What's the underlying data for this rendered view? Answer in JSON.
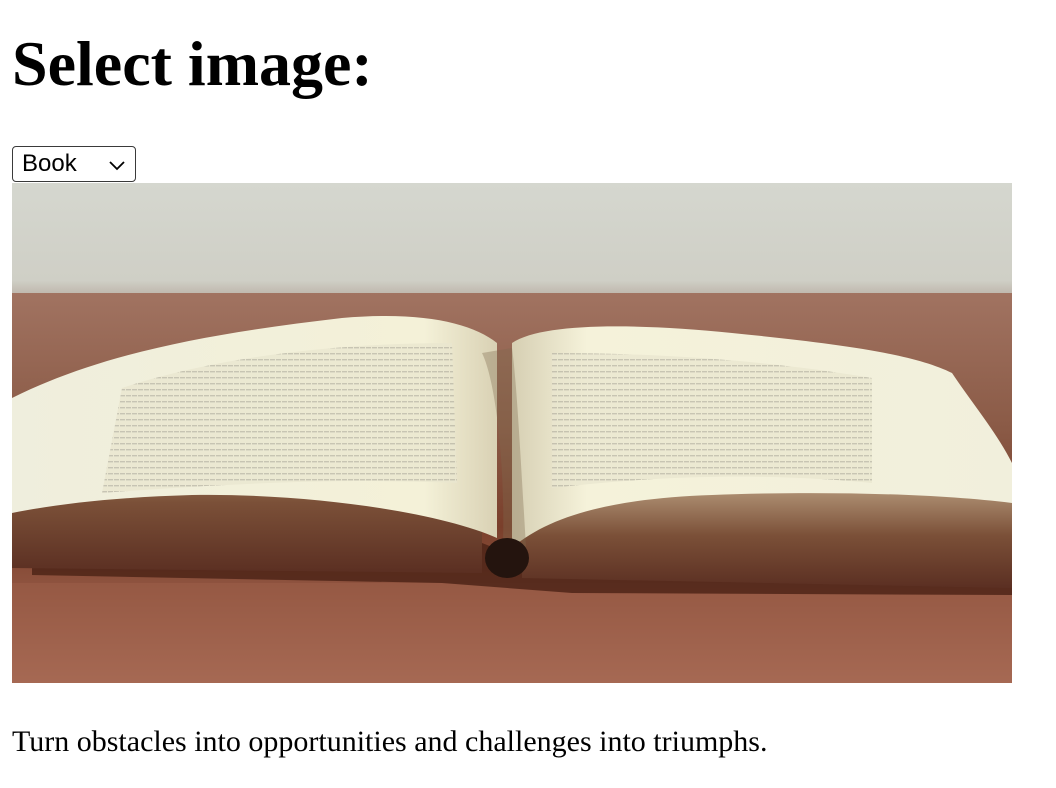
{
  "page": {
    "title": "Select image:"
  },
  "image_select": {
    "selected": "Book",
    "icon": "chevron-down-icon"
  },
  "image": {
    "subject": "open-book",
    "colors": {
      "wall": "#d6d7cf",
      "table": "#8a4c36",
      "paper": "#f3efd7",
      "edge": "#6b3c28"
    }
  },
  "caption": {
    "text": "Turn obstacles into opportunities and challenges into triumphs."
  }
}
